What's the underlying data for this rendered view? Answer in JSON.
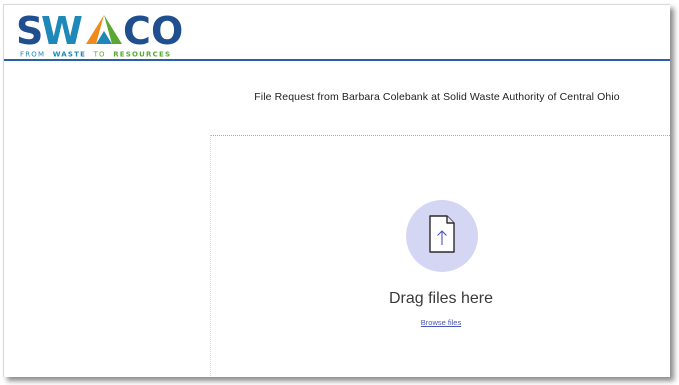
{
  "header": {
    "logo": {
      "wordmark": "SWACO",
      "tagline": "FROM WASTE TO RESOURCES",
      "tagline_parts": [
        "FROM",
        "WASTE",
        "TO",
        "RESOURCES"
      ],
      "colors": {
        "navy": "#1f4f8f",
        "teal": "#1e88b8",
        "green": "#5aa832",
        "orange": "#f08a1c"
      }
    },
    "rule_color": "#2b5fa8"
  },
  "main": {
    "title": "File Request from Barbara Colebank at Solid Waste Authority of Central Ohio",
    "dropzone": {
      "icon": "file-upload-icon",
      "heading": "Drag files here",
      "browse_label": "Browse files",
      "icon_circle_color": "#d4d6f4",
      "link_color": "#4a55b8"
    }
  }
}
